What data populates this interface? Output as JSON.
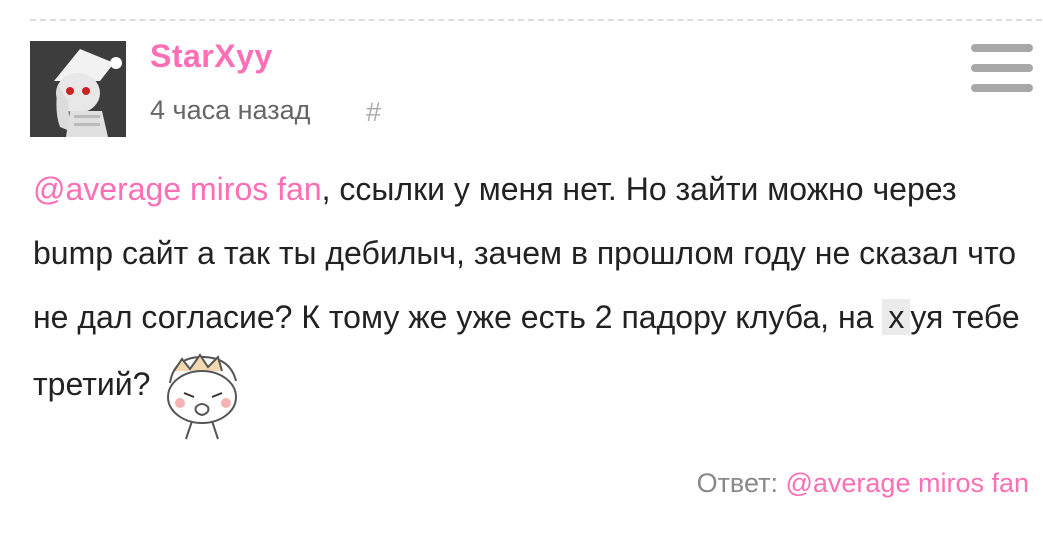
{
  "post": {
    "username": "StarXyy",
    "time": "4 часа назад",
    "hash": "#",
    "comment": {
      "mention": "@average miros fan",
      "text_1": ", ссылки у меня нет. Но зайти можно через bump сайт а так ты дебилыч, зачем в прошлом году не сказал что не дал согласие? К тому же уже есть 2 падору клуба, на",
      "highlight": "х",
      "text_2": "уя тебе третий?"
    },
    "reply": {
      "label": "Ответ:",
      "mention": "@average miros fan"
    }
  },
  "icons": {
    "menu": "hamburger-menu-icon",
    "sticker": "crying-face-sticker"
  },
  "colors": {
    "username": "#ff6fb5",
    "mention": "#ff6fb5",
    "divider": "#dcdcdc",
    "menu": "#a8a8a8"
  }
}
